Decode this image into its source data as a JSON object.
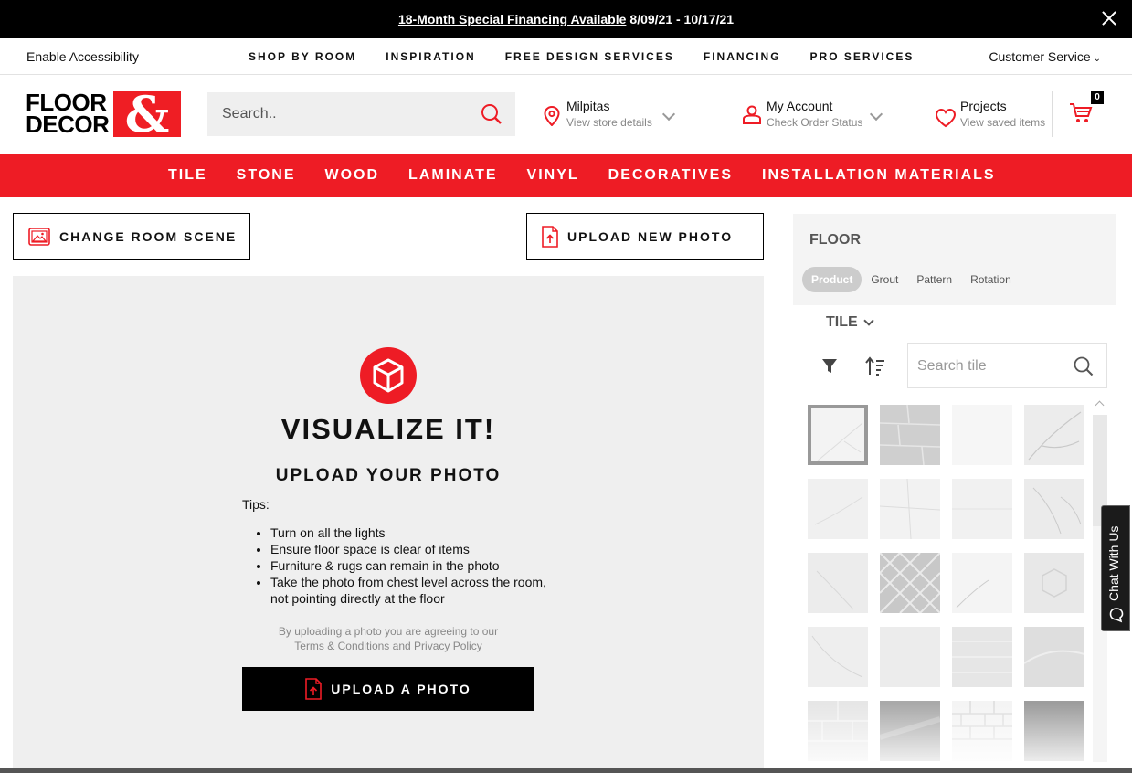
{
  "promo": {
    "link_text": "18-Month Special Financing Available",
    "dates": "8/09/21 - 10/17/21"
  },
  "utility_nav": {
    "accessibility": "Enable Accessibility",
    "items": [
      "SHOP BY ROOM",
      "INSPIRATION",
      "FREE DESIGN SERVICES",
      "FINANCING",
      "PRO SERVICES"
    ],
    "customer_service": "Customer Service"
  },
  "header": {
    "logo_line1": "FLOOR",
    "logo_line2": "DECOR",
    "logo_amp": "&",
    "search_placeholder": "Search..",
    "store": {
      "title": "Milpitas",
      "subtitle": "View store details"
    },
    "account": {
      "title": "My Account",
      "subtitle": "Check Order Status"
    },
    "projects": {
      "title": "Projects",
      "subtitle": "View saved items"
    },
    "cart_count": "0"
  },
  "categories": [
    "TILE",
    "STONE",
    "WOOD",
    "LAMINATE",
    "VINYL",
    "DECORATIVES",
    "INSTALLATION MATERIALS"
  ],
  "actions": {
    "change_room": "CHANGE ROOM SCENE",
    "upload_new": "UPLOAD NEW PHOTO"
  },
  "visualizer": {
    "title": "VISUALIZE IT!",
    "subtitle": "UPLOAD YOUR PHOTO",
    "tips_heading": "Tips:",
    "tips": [
      "Turn on all the lights",
      "Ensure floor space is clear of items",
      "Furniture & rugs can remain in the photo",
      "Take the photo from chest level across the room, not pointing directly at the floor"
    ],
    "legal_line1": "By uploading a photo you are agreeing to our",
    "terms": "Terms & Conditions",
    "and": "and",
    "privacy": "Privacy Policy",
    "upload_button": "UPLOAD A PHOTO"
  },
  "panel": {
    "heading": "FLOOR",
    "tabs": [
      "Product",
      "Grout",
      "Pattern",
      "Rotation"
    ],
    "active_tab": "Product",
    "category_dropdown": "TILE",
    "search_placeholder": "Search tile"
  },
  "chat": {
    "label": "Chat With Us"
  },
  "colors": {
    "brand_red": "#ee1c25",
    "black": "#000000",
    "panel_gray": "#efefef"
  }
}
